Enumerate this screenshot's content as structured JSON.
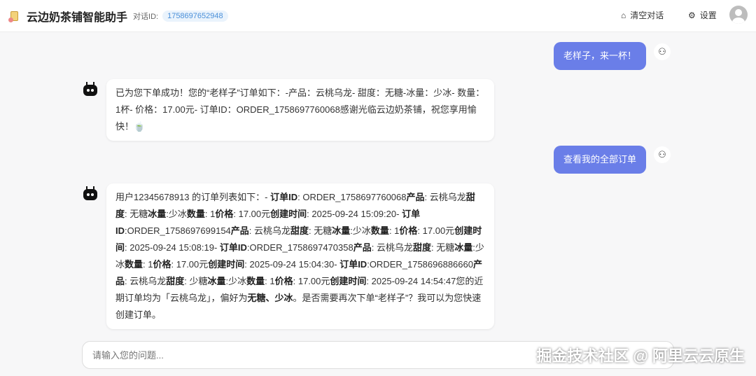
{
  "header": {
    "title": "云边奶茶铺智能助手",
    "conversation_id_label": "对话ID:",
    "conversation_id": "1758697652948",
    "clear_label": "清空对话",
    "settings_label": "设置"
  },
  "messages": [
    {
      "role": "user",
      "text": "老样子，来一杯！"
    },
    {
      "role": "bot",
      "text": "已为您下单成功！您的“老样子”订单如下：-产品：云桃乌龙- 甜度：无糖-冰量：少冰- 数量：1杯- 价格：17.00元- 订单ID：ORDER_1758697760068感谢光临云边奶茶铺，祝您享用愉快！🍵"
    },
    {
      "role": "user",
      "text": "查看我的全部订单"
    },
    {
      "role": "bot",
      "segments": [
        {
          "t": "用户12345678913 的订单列表如下：- "
        },
        {
          "t": "订单ID",
          "b": 1
        },
        {
          "t": ": ORDER_1758697760068"
        },
        {
          "t": "产品",
          "b": 1
        },
        {
          "t": ": 云桃乌龙"
        },
        {
          "t": "甜度",
          "b": 1
        },
        {
          "t": ": 无糖"
        },
        {
          "t": "冰量",
          "b": 1
        },
        {
          "t": ":少冰"
        },
        {
          "t": "数量",
          "b": 1
        },
        {
          "t": ": 1"
        },
        {
          "t": "价格",
          "b": 1
        },
        {
          "t": ": 17.00元"
        },
        {
          "t": "创建时间",
          "b": 1
        },
        {
          "t": ": 2025-09-24 15:09:20- "
        },
        {
          "t": "订单ID",
          "b": 1
        },
        {
          "t": ":ORDER_1758697699154"
        },
        {
          "t": "产品",
          "b": 1
        },
        {
          "t": ": 云桃乌龙"
        },
        {
          "t": "甜度",
          "b": 1
        },
        {
          "t": ": 无糖"
        },
        {
          "t": "冰量",
          "b": 1
        },
        {
          "t": ":少冰"
        },
        {
          "t": "数量",
          "b": 1
        },
        {
          "t": ": 1"
        },
        {
          "t": "价格",
          "b": 1
        },
        {
          "t": ": 17.00元"
        },
        {
          "t": "创建时间",
          "b": 1
        },
        {
          "t": ": 2025-09-24 15:08:19- "
        },
        {
          "t": "订单ID",
          "b": 1
        },
        {
          "t": ":ORDER_1758697470358"
        },
        {
          "t": "产品",
          "b": 1
        },
        {
          "t": ": 云桃乌龙"
        },
        {
          "t": "甜度",
          "b": 1
        },
        {
          "t": ": 无糖"
        },
        {
          "t": "冰量",
          "b": 1
        },
        {
          "t": ":少冰"
        },
        {
          "t": "数量",
          "b": 1
        },
        {
          "t": ": 1"
        },
        {
          "t": "价格",
          "b": 1
        },
        {
          "t": ": 17.00元"
        },
        {
          "t": "创建时间",
          "b": 1
        },
        {
          "t": ": 2025-09-24 15:04:30- "
        },
        {
          "t": "订单ID",
          "b": 1
        },
        {
          "t": ":ORDER_1758696886660"
        },
        {
          "t": "产品",
          "b": 1
        },
        {
          "t": ": 云桃乌龙"
        },
        {
          "t": "甜度",
          "b": 1
        },
        {
          "t": ": 少糖"
        },
        {
          "t": "冰量",
          "b": 1
        },
        {
          "t": ":少冰"
        },
        {
          "t": "数量",
          "b": 1
        },
        {
          "t": ": 1"
        },
        {
          "t": "价格",
          "b": 1
        },
        {
          "t": ": 17.00元"
        },
        {
          "t": "创建时间",
          "b": 1
        },
        {
          "t": ": 2025-09-24 14:54:47您的近期订单均为「云桃乌龙」，偏好为"
        },
        {
          "t": "无糖、少冰",
          "b": 1
        },
        {
          "t": "。是否需要再次下单“老样子”？我可以为您快速创建订单。"
        }
      ]
    }
  ],
  "input": {
    "placeholder": "请输入您的问题..."
  },
  "watermark": "掘金技术社区 @ 阿里云云原生",
  "colors": {
    "user_bubble": "#6a7ee8",
    "id_badge": "#4a8fd9"
  }
}
